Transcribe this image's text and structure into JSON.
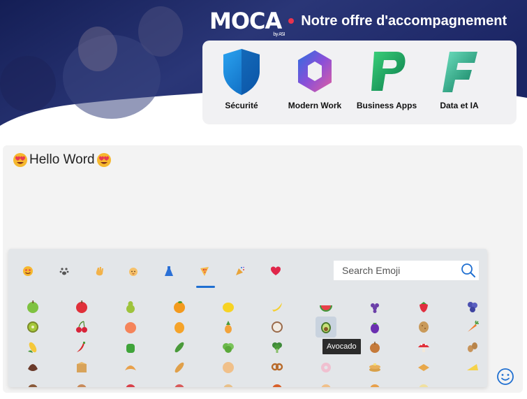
{
  "banner": {
    "brand_logo": "MOCA",
    "brand_by": "by ASI",
    "brand_title": "Notre offre d'accompagnement",
    "offers": [
      {
        "label": "Sécurité",
        "icon": "shield-icon"
      },
      {
        "label": "Modern Work",
        "icon": "microsoft365-icon"
      },
      {
        "label": "Business Apps",
        "icon": "power-platform-icon"
      },
      {
        "label": "Data et IA",
        "icon": "fabric-icon"
      }
    ]
  },
  "editor": {
    "text": "Hello Word",
    "leading_emoji": "smiling-face-with-heart-eyes",
    "trailing_emoji": "smiling-face-with-heart-eyes"
  },
  "picker": {
    "categories": [
      "smileys",
      "animals",
      "people",
      "baby",
      "clothing",
      "food",
      "celebration",
      "symbols"
    ],
    "active_category": "food",
    "search_placeholder": "Search Emoji",
    "tooltip": "Avocado",
    "hovered": "avocado",
    "rows": [
      [
        "green-apple",
        "red-apple",
        "pear",
        "tangerine",
        "lemon",
        "banana",
        "watermelon",
        "grapes",
        "strawberry",
        "blueberries"
      ],
      [
        "kiwi",
        "cherries",
        "peach",
        "mango",
        "pineapple",
        "coconut",
        "avocado",
        "eggplant",
        "potato",
        "carrot"
      ],
      [
        "corn",
        "hot-pepper",
        "bell-pepper",
        "cucumber",
        "leafy-green",
        "broccoli",
        "garlic",
        "onion",
        "mushroom",
        "peanuts"
      ],
      [
        "chestnut",
        "box",
        "croissant",
        "baguette",
        "flatbread",
        "pretzel",
        "bagel",
        "pancakes",
        "waffle",
        "cheese"
      ]
    ],
    "colors": {
      "active_underline": "#1f6fd1",
      "accent": "#e8344e"
    }
  }
}
